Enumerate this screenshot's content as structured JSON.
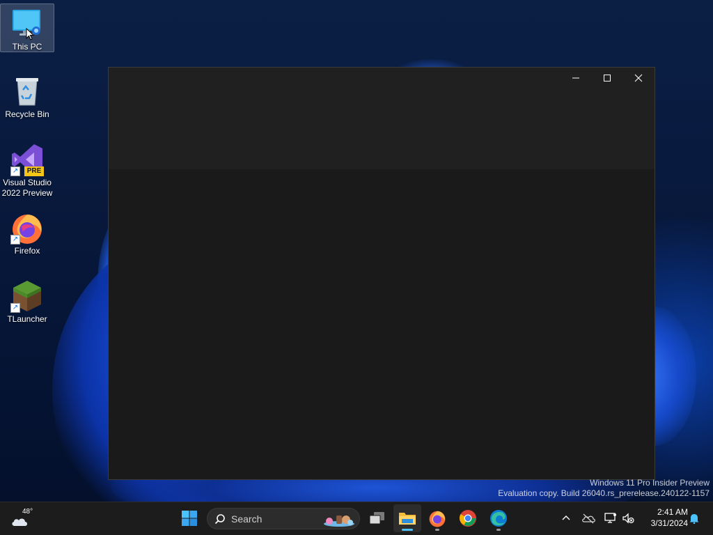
{
  "desktop": {
    "icons": [
      {
        "label": "This PC",
        "icon": "monitor-icon"
      },
      {
        "label": "Recycle Bin",
        "icon": "recycle-bin-icon"
      },
      {
        "label": "Visual Studio 2022 Preview",
        "icon": "visual-studio-icon",
        "badge": "PRE"
      },
      {
        "label": "Firefox",
        "icon": "firefox-icon"
      },
      {
        "label": "TLauncher",
        "icon": "grass-block-icon"
      }
    ]
  },
  "window": {
    "minimize": "minimize-icon",
    "maximize": "maximize-icon",
    "close": "close-icon"
  },
  "watermark": {
    "line1": "Windows 11 Pro Insider Preview",
    "line2": "Evaluation copy. Build 26040.rs_prerelease.240122-1157"
  },
  "taskbar": {
    "weather_temp": "48°",
    "search_placeholder": "Search",
    "apps": [
      "start-icon",
      "task-view-icon",
      "file-explorer-icon",
      "firefox-icon",
      "chrome-icon",
      "edge-icon"
    ],
    "clock": {
      "time": "2:41 AM",
      "date": "3/31/2024"
    }
  },
  "colors": {
    "accent": "#4cc2ff",
    "taskbar": "#1c1c1c",
    "window_title": "#202020",
    "window_body": "#1a1a1a"
  }
}
